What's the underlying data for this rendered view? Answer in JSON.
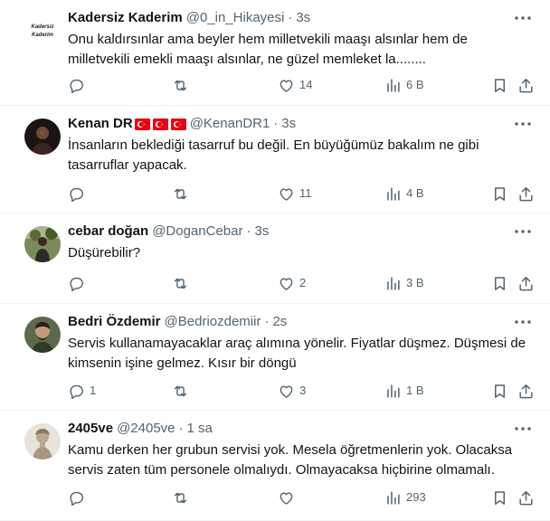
{
  "tweets": [
    {
      "name": "Kadersiz Kaderim",
      "handle": "@0_in_Hikayesi",
      "time": "3s",
      "text": "Onu kaldırsınlar ama beyler hem milletvekili maaşı alsınlar hem de milletvekili emekli maaşı alsınlar,  ne güzel memleket la........",
      "flags": [],
      "replies": "",
      "retweets": "",
      "likes": "14",
      "views": "6 B",
      "avatar_icon": "text-logo-avatar"
    },
    {
      "name": "Kenan DR",
      "handle": "@KenanDR1",
      "time": "3s",
      "text": "İnsanların beklediği tasarruf bu değil. En büyüğümüz bakalım ne gibi tasarruflar yapacak.",
      "flags": [
        "turkey-flag",
        "turkey-flag",
        "turkey-flag"
      ],
      "replies": "",
      "retweets": "",
      "likes": "11",
      "views": "4 B",
      "avatar_icon": "dark-portrait-avatar"
    },
    {
      "name": "cebar doğan",
      "handle": "@DoganCebar",
      "time": "3s",
      "text": "Düşürebilir?",
      "flags": [],
      "replies": "",
      "retweets": "",
      "likes": "2",
      "views": "3 B",
      "avatar_icon": "outdoor-person-avatar"
    },
    {
      "name": "Bedri Özdemir",
      "handle": "@Bedriozdemiir",
      "time": "2s",
      "text": "Servis kullanamayacaklar araç alımına yönelir. Fiyatlar düşmez. Düşmesi de kimsenin işine gelmez. Kısır bir döngü",
      "flags": [],
      "replies": "1",
      "retweets": "",
      "likes": "3",
      "views": "1 B",
      "avatar_icon": "man-portrait-avatar"
    },
    {
      "name": "2405ve",
      "handle": "@2405ve",
      "time": "1 sa",
      "text": "Kamu derken her grubun servisi yok. Mesela öğretmenlerin yok. Olacaksa servis zaten tüm personele olmalıydı. Olmayacaksa hiçbirine olmamalı.",
      "flags": [],
      "replies": "",
      "retweets": "",
      "likes": "",
      "views": "293",
      "avatar_icon": "statue-avatar"
    }
  ],
  "separator": "·",
  "icons": {
    "reply": "reply-bubble-icon",
    "retweet": "retweet-icon",
    "like": "heart-icon",
    "views": "views-bar-chart-icon",
    "bookmark": "bookmark-icon",
    "share": "share-upload-icon",
    "more": "more-dots-icon"
  },
  "avatar_logo_text": [
    "Kadersiz",
    "Kaderim"
  ],
  "colors": {
    "text": "#0f1419",
    "secondary": "#536471",
    "divider": "#eff3f4",
    "flag_red": "#e30a17"
  }
}
